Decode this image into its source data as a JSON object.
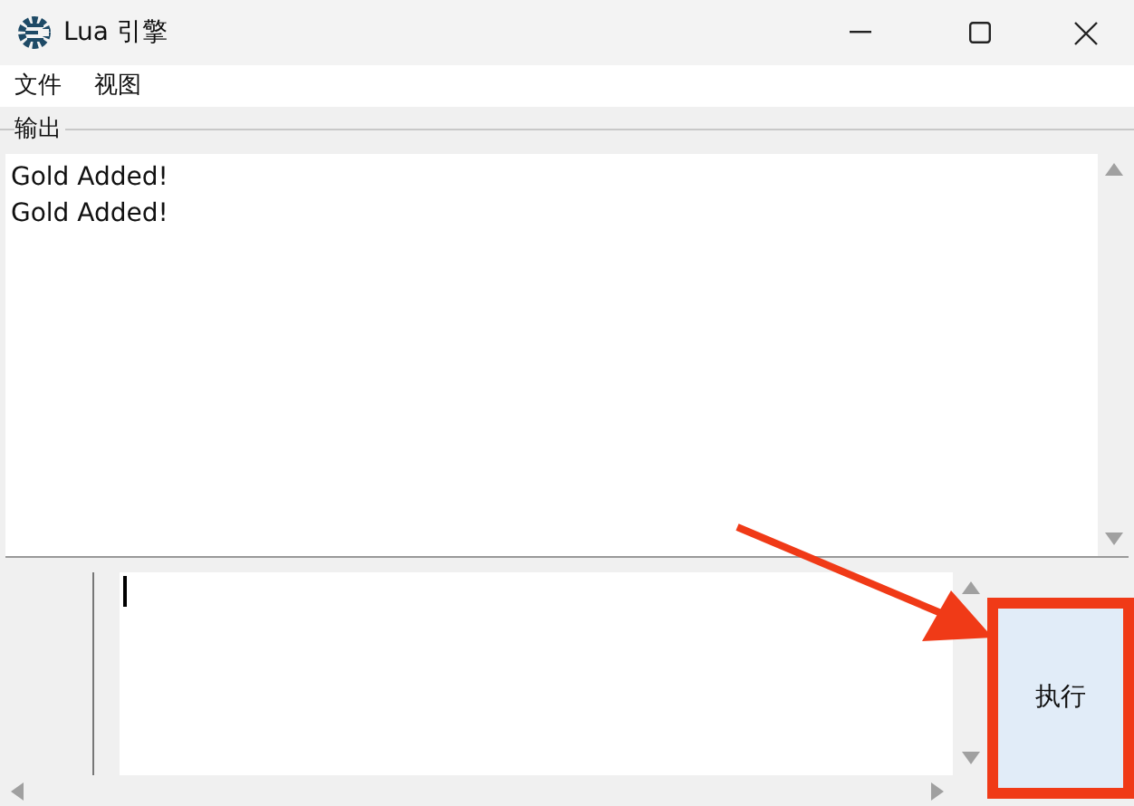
{
  "window": {
    "title": "Lua 引擎"
  },
  "menu": [
    "文件",
    "视图"
  ],
  "output": {
    "label": "输出",
    "lines": [
      "Gold Added!",
      "Gold Added!"
    ]
  },
  "run_button": {
    "label": "执行",
    "highlighted": true
  }
}
